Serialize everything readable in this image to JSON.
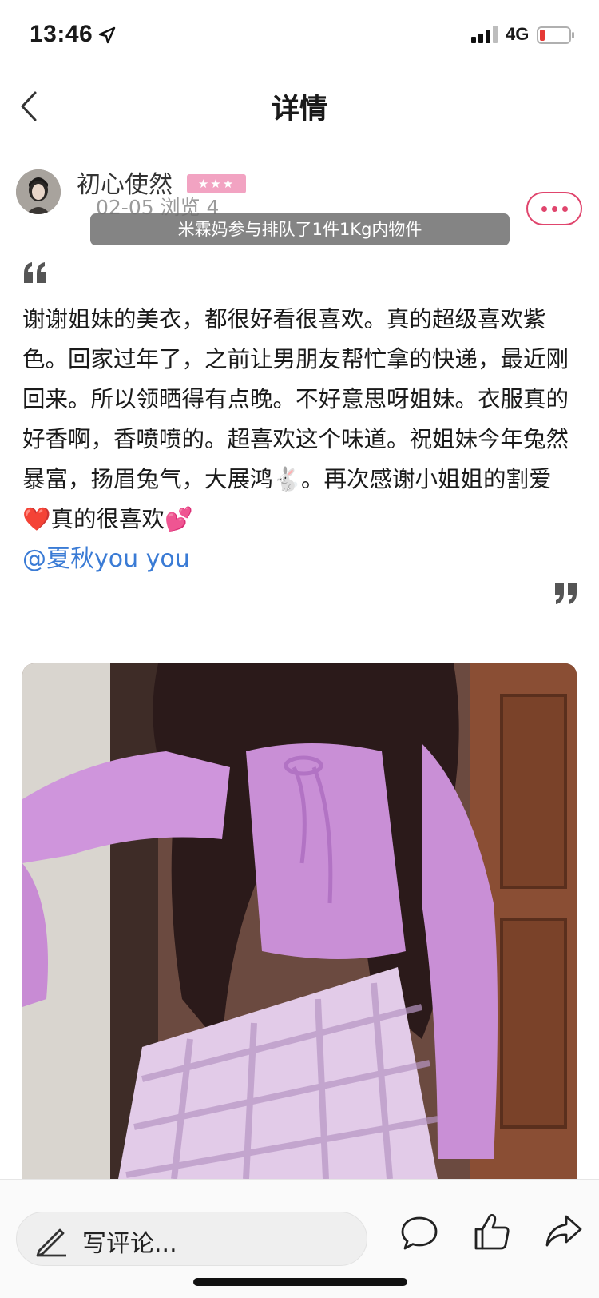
{
  "status_bar": {
    "time": "13:46",
    "network": "4G"
  },
  "nav": {
    "title": "详情"
  },
  "post": {
    "author": "初心使然",
    "badge": "★★★",
    "date_views": "02-05 浏览 4",
    "toast": "米霖妈参与排队了1件1Kg内物件",
    "body": "谢谢姐妹的美衣，都很好看很喜欢。真的超级喜欢紫色。回家过年了，之前让男朋友帮忙拿的快递，最近刚回来。所以领晒得有点晚。不好意思呀姐妹。衣服真的好香啊，香喷喷的。超喜欢这个味道。祝姐妹今年兔然暴富，扬眉兔气，大展鸿🐇。再次感谢小姐姐的割爱❤️真的很喜欢💕",
    "mention": "@夏秋you you"
  },
  "bottom_bar": {
    "comment_placeholder": "写评论..."
  },
  "colors": {
    "accent": "#e0456d",
    "link": "#3a7bd5",
    "badge": "#f2a3c2"
  },
  "icons": [
    "location-arrow-icon",
    "signal-icon",
    "battery-icon",
    "back-chevron-icon",
    "more-dots-icon",
    "quote-open-icon",
    "quote-close-icon",
    "pen-icon",
    "comment-bubble-icon",
    "thumbs-up-icon",
    "share-arrow-icon"
  ]
}
